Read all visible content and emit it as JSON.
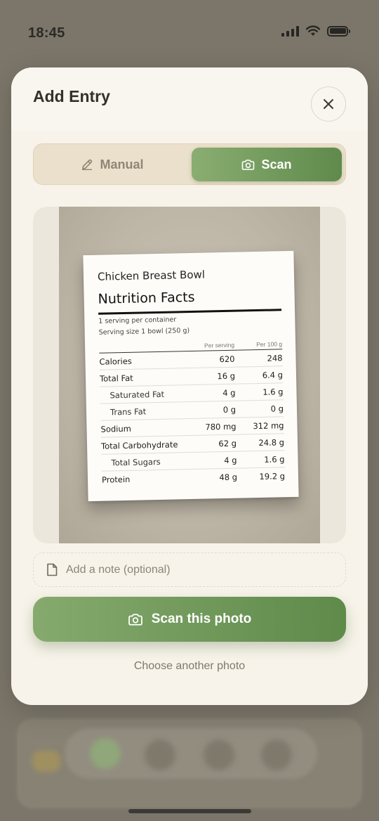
{
  "status_bar": {
    "time": "18:45"
  },
  "modal": {
    "title": "Add Entry",
    "close_icon": "close-icon",
    "tabs": [
      {
        "label": "Manual",
        "icon": "pencil-icon",
        "selected": false
      },
      {
        "label": "Scan",
        "icon": "camera-icon",
        "selected": true
      }
    ],
    "photo": {
      "product": "Chicken Breast Bowl",
      "heading": "Nutrition Facts",
      "servings": "1 serving per container",
      "serving_size": "Serving size 1 bowl (250 g)",
      "columns": [
        "Per serving",
        "Per 100 g"
      ],
      "rows": [
        {
          "name": "Calories",
          "per_serving": "620",
          "per_100g": "248",
          "indent": false
        },
        {
          "name": "Total Fat",
          "per_serving": "16 g",
          "per_100g": "6.4 g",
          "indent": false
        },
        {
          "name": "Saturated Fat",
          "per_serving": "4 g",
          "per_100g": "1.6 g",
          "indent": true
        },
        {
          "name": "Trans Fat",
          "per_serving": "0 g",
          "per_100g": "0 g",
          "indent": true
        },
        {
          "name": "Sodium",
          "per_serving": "780 mg",
          "per_100g": "312 mg",
          "indent": false
        },
        {
          "name": "Total Carbohydrate",
          "per_serving": "62 g",
          "per_100g": "24.8 g",
          "indent": false
        },
        {
          "name": "Total Sugars",
          "per_serving": "4 g",
          "per_100g": "1.6 g",
          "indent": true
        },
        {
          "name": "Protein",
          "per_serving": "48 g",
          "per_100g": "19.2 g",
          "indent": false
        }
      ]
    },
    "note": {
      "placeholder": "Add a note (optional)",
      "value": ""
    },
    "scan_button": "Scan this photo",
    "choose_link": "Choose another photo"
  },
  "colors": {
    "accent": "#6f9659",
    "background": "#f7f3ea",
    "toggle_bg": "#ebe0cb"
  }
}
